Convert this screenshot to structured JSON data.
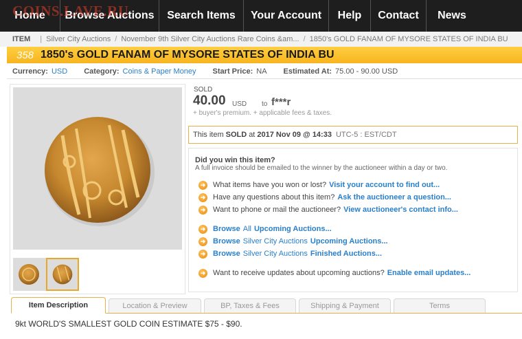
{
  "watermark": "COINS.LAVE.RU",
  "nav": {
    "items": [
      {
        "label": "Home"
      },
      {
        "label": "Browse Auctions"
      },
      {
        "label": "Search Items"
      },
      {
        "label": "Your Account"
      },
      {
        "label": "Help"
      },
      {
        "label": "Contact"
      },
      {
        "label": "News"
      }
    ]
  },
  "breadcrumb": {
    "label": "ITEM",
    "crumbs": [
      "Silver City Auctions",
      "November 9th Silver City Auctions Rare Coins &am...",
      "1850's GOLD FANAM OF MYSORE STATES OF INDIA BU"
    ]
  },
  "lot": {
    "number": "358",
    "title": "1850's GOLD FANAM OF MYSORE STATES OF INDIA BU"
  },
  "info": {
    "currency_label": "Currency:",
    "currency_value": "USD",
    "category_label": "Category:",
    "category_value": "Coins & Paper Money",
    "start_label": "Start Price:",
    "start_value": "NA",
    "estimate_label": "Estimated At:",
    "estimate_value": "75.00 - 90.00 USD"
  },
  "sale": {
    "status": "SOLD",
    "price": "40.00",
    "currency": "USD",
    "to": "to",
    "buyer": "f***r",
    "fees": "+ buyer's premium. + applicable fees & taxes.",
    "sold_prefix": "This item",
    "sold_word": "SOLD",
    "sold_at": "at",
    "sold_date": "2017 Nov 09 @ 14:33",
    "sold_tz": "UTC-5 : EST/CDT"
  },
  "faq": {
    "q1": "Did you win this item?",
    "a1": "A full invoice should be emailed to the winner by the auctioneer within a day or two.",
    "rows": [
      {
        "text": "What items have you won or lost?",
        "link": "Visit your account to find out..."
      },
      {
        "text": "Have any questions about this item?",
        "link": "Ask the auctioneer a question..."
      },
      {
        "text": "Want to phone or mail the auctioneer?",
        "link": "View auctioneer's contact info..."
      }
    ],
    "browse": [
      {
        "a": "Browse",
        "b": "All",
        "c": "Upcoming Auctions..."
      },
      {
        "a": "Browse",
        "b": "Silver City Auctions",
        "c": "Upcoming Auctions..."
      },
      {
        "a": "Browse",
        "b": "Silver City Auctions",
        "c": "Finished Auctions..."
      }
    ],
    "updates": {
      "text": "Want to receive updates about upcoming auctions?",
      "link": "Enable email updates..."
    }
  },
  "tabs": [
    {
      "label": "Item Description"
    },
    {
      "label": "Location & Preview"
    },
    {
      "label": "BP, Taxes & Fees"
    },
    {
      "label": "Shipping & Payment"
    },
    {
      "label": "Terms"
    }
  ],
  "description": "9kt WORLD'S SMALLEST GOLD COIN ESTIMATE $75 - $90.",
  "icons": {
    "bullet": "arrow-right-circle-icon"
  },
  "colors": {
    "accent": "#f7b41f",
    "link": "#2a7fc9",
    "nav_bg": "#1e1e1e",
    "coin": "#c7892f"
  }
}
